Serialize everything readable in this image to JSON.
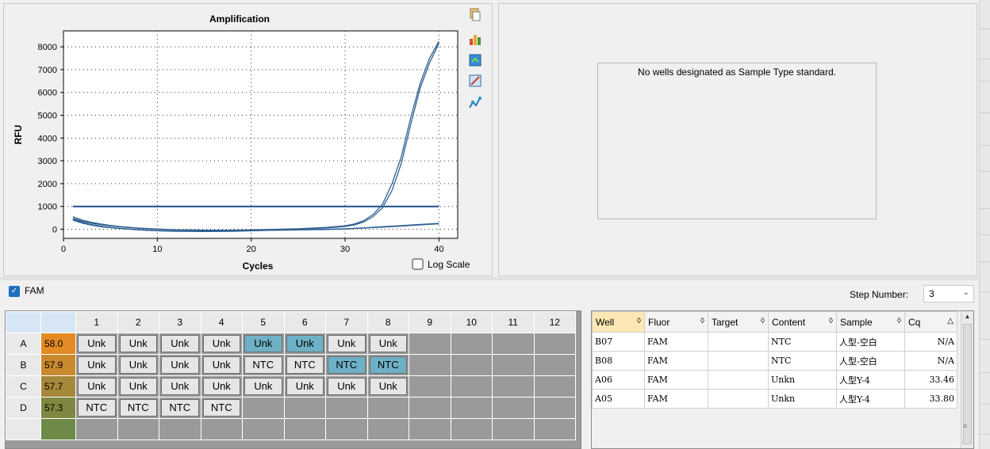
{
  "chart": {
    "toolbar_icons": [
      "copy-icon",
      "chart-style-icon",
      "export-icon",
      "zoom-icon",
      "trace-icon"
    ],
    "log_scale_label": "Log Scale",
    "log_scale_checked": false,
    "colors": {
      "curve": "#2f5f93",
      "threshold": "#1f4f8a"
    }
  },
  "chart_data": {
    "type": "line",
    "title": "Amplification",
    "xlabel": "Cycles",
    "ylabel": "RFU",
    "xlim": [
      0,
      42
    ],
    "ylim": [
      -400,
      8700
    ],
    "xticks": [
      0,
      10,
      20,
      30,
      40
    ],
    "yticks": [
      0,
      1000,
      2000,
      3000,
      4000,
      5000,
      6000,
      7000,
      8000
    ],
    "grid": true,
    "threshold": 1000,
    "series": [
      {
        "x": [
          1,
          2,
          3,
          4,
          5,
          6,
          8,
          10,
          12,
          15,
          18,
          20,
          22,
          25,
          28,
          30,
          31,
          32,
          33,
          34,
          35,
          36,
          37,
          38,
          39,
          40
        ],
        "y": [
          550,
          400,
          300,
          230,
          170,
          120,
          50,
          10,
          -20,
          -40,
          -40,
          -30,
          -10,
          20,
          80,
          150,
          230,
          380,
          650,
          1100,
          2000,
          3200,
          4900,
          6400,
          7500,
          8250
        ]
      },
      {
        "x": [
          1,
          2,
          3,
          4,
          5,
          6,
          8,
          10,
          12,
          15,
          18,
          20,
          22,
          25,
          28,
          30,
          31,
          32,
          33,
          34,
          35,
          36,
          37,
          38,
          39,
          40
        ],
        "y": [
          480,
          350,
          260,
          200,
          150,
          110,
          40,
          0,
          -30,
          -50,
          -50,
          -40,
          -20,
          10,
          60,
          120,
          190,
          320,
          560,
          950,
          1700,
          2900,
          4600,
          6200,
          7300,
          8150
        ]
      },
      {
        "x": [
          1,
          2,
          3,
          4,
          5,
          6,
          8,
          10,
          12,
          15,
          18,
          20,
          22,
          25,
          28,
          30,
          32,
          34,
          36,
          38,
          40
        ],
        "y": [
          450,
          300,
          200,
          130,
          80,
          40,
          -20,
          -60,
          -80,
          -90,
          -80,
          -60,
          -40,
          -20,
          0,
          20,
          60,
          110,
          160,
          210,
          260
        ]
      },
      {
        "x": [
          1,
          2,
          3,
          4,
          5,
          6,
          8,
          10,
          12,
          15,
          18,
          20,
          22,
          25,
          28,
          30,
          32,
          34,
          36,
          38,
          40
        ],
        "y": [
          400,
          270,
          180,
          110,
          70,
          30,
          -30,
          -70,
          -90,
          -100,
          -90,
          -70,
          -50,
          -30,
          -10,
          10,
          50,
          90,
          140,
          190,
          240
        ]
      }
    ]
  },
  "std_curve": {
    "message": "No wells designated as Sample Type standard."
  },
  "fluor_bar": {
    "fam_label": "FAM",
    "fam_checked": true,
    "step_label": "Step Number:",
    "step_value": "3"
  },
  "plate": {
    "columns": [
      "1",
      "2",
      "3",
      "4",
      "5",
      "6",
      "7",
      "8",
      "9",
      "10",
      "11",
      "12"
    ],
    "rows": [
      {
        "label": "A",
        "temp": "58.0",
        "temp_color": "#e48a22",
        "wells": [
          {
            "t": "Unk",
            "s": false
          },
          {
            "t": "Unk",
            "s": false
          },
          {
            "t": "Unk",
            "s": false
          },
          {
            "t": "Unk",
            "s": false
          },
          {
            "t": "Unk",
            "s": true
          },
          {
            "t": "Unk",
            "s": true
          },
          {
            "t": "Unk",
            "s": false
          },
          {
            "t": "Unk",
            "s": false
          },
          null,
          null,
          null,
          null
        ]
      },
      {
        "label": "B",
        "temp": "57.9",
        "temp_color": "#c98a2e",
        "wells": [
          {
            "t": "Unk",
            "s": false
          },
          {
            "t": "Unk",
            "s": false
          },
          {
            "t": "Unk",
            "s": false
          },
          {
            "t": "Unk",
            "s": false
          },
          {
            "t": "NTC",
            "s": false
          },
          {
            "t": "NTC",
            "s": false
          },
          {
            "t": "NTC",
            "s": true
          },
          {
            "t": "NTC",
            "s": true
          },
          null,
          null,
          null,
          null
        ]
      },
      {
        "label": "C",
        "temp": "57.7",
        "temp_color": "#a6883a",
        "wells": [
          {
            "t": "Unk",
            "s": false
          },
          {
            "t": "Unk",
            "s": false
          },
          {
            "t": "Unk",
            "s": false
          },
          {
            "t": "Unk",
            "s": false
          },
          {
            "t": "Unk",
            "s": false
          },
          {
            "t": "Unk",
            "s": false
          },
          {
            "t": "Unk",
            "s": false
          },
          {
            "t": "Unk",
            "s": false
          },
          null,
          null,
          null,
          null
        ]
      },
      {
        "label": "D",
        "temp": "57.3",
        "temp_color": "#7f8740",
        "wells": [
          {
            "t": "NTC",
            "s": false
          },
          {
            "t": "NTC",
            "s": false
          },
          {
            "t": "NTC",
            "s": false
          },
          {
            "t": "NTC",
            "s": false
          },
          null,
          null,
          null,
          null,
          null,
          null,
          null,
          null
        ]
      }
    ]
  },
  "results": {
    "columns": [
      "Well",
      "Fluor",
      "Target",
      "Content",
      "Sample",
      "Cq"
    ],
    "rows": [
      [
        "B07",
        "FAM",
        "",
        "NTC",
        "人型-空白",
        "N/A"
      ],
      [
        "B08",
        "FAM",
        "",
        "NTC",
        "人型-空白",
        "N/A"
      ],
      [
        "A06",
        "FAM",
        "",
        "Unkn",
        "人型Y-4",
        "33.46"
      ],
      [
        "A05",
        "FAM",
        "",
        "Unkn",
        "人型Y-4",
        "33.80"
      ]
    ]
  }
}
